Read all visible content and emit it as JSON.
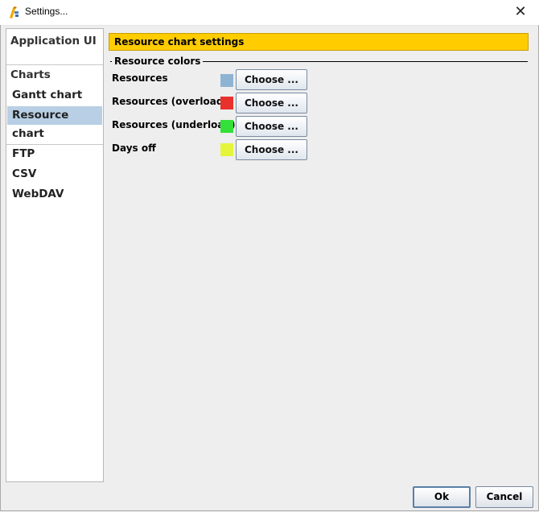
{
  "window": {
    "title": "Settings...",
    "close_glyph": "✕"
  },
  "sidebar": {
    "items": [
      {
        "label": "Application UI",
        "kind": "group"
      },
      {
        "label": "Charts",
        "kind": "group"
      },
      {
        "label": "Gantt chart",
        "kind": "item"
      },
      {
        "label": "Resource chart",
        "kind": "item",
        "selected": true
      },
      {
        "label": "FTP",
        "kind": "item"
      },
      {
        "label": "CSV",
        "kind": "item"
      },
      {
        "label": "WebDAV",
        "kind": "item"
      }
    ]
  },
  "panel": {
    "header": "Resource chart settings",
    "header_color": "#ffcc00",
    "section_title": "Resource colors",
    "rows": [
      {
        "label": "Resources",
        "color": "#8fb3d3",
        "button": "Choose ..."
      },
      {
        "label": "Resources (overload)",
        "color": "#e8302c",
        "button": "Choose ..."
      },
      {
        "label": "Resources (underload)",
        "color": "#33e03a",
        "button": "Choose ..."
      },
      {
        "label": "Days off",
        "color": "#e4f53c",
        "button": "Choose ..."
      }
    ]
  },
  "footer": {
    "ok_label": "Ok",
    "cancel_label": "Cancel"
  },
  "icons": {
    "app": "ganttproject-icon",
    "close": "close-icon"
  }
}
